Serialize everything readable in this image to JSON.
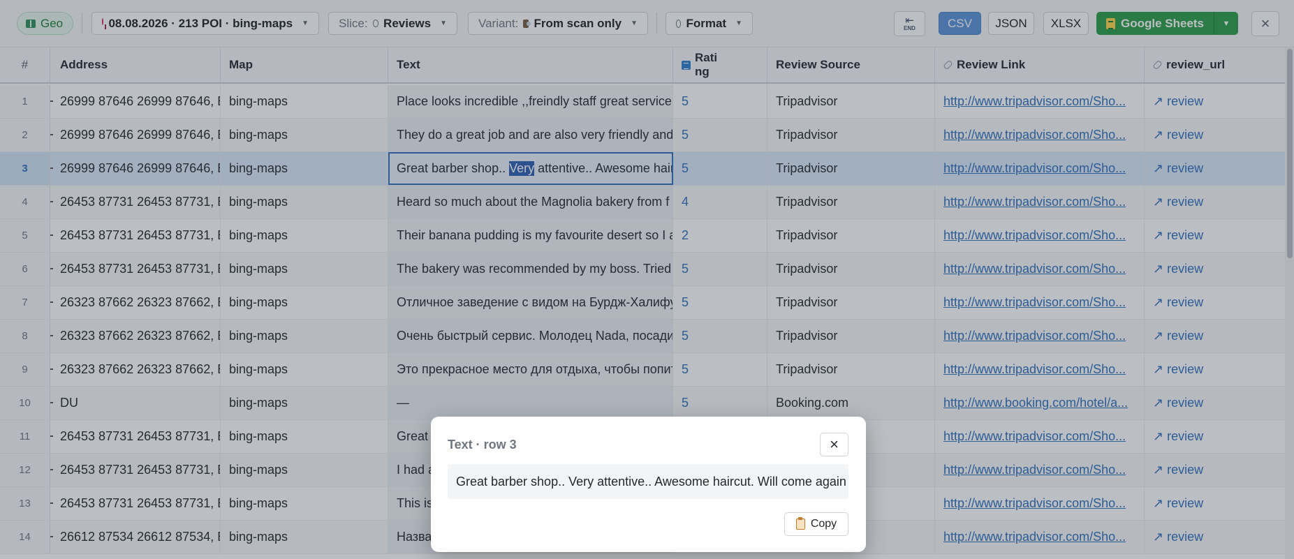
{
  "toolbar": {
    "geo": {
      "label": "Geo"
    },
    "date": {
      "value": "08.08.2026 · 213 POI · bing-maps"
    },
    "slice": {
      "label": "Slice:",
      "value": "Reviews"
    },
    "variant": {
      "label": "Variant:",
      "value": "From scan only"
    },
    "format": {
      "label": "Format"
    },
    "end_button": {
      "label": "END"
    },
    "export": {
      "csv": "CSV",
      "json": "JSON",
      "xlsx": "XLSX",
      "google_sheets": "Google Sheets"
    },
    "close": "×"
  },
  "table": {
    "columns": {
      "num": "#",
      "address": "Address",
      "map": "Map",
      "text": "Text",
      "rating_1": "Rati",
      "rating_2": "ng",
      "source": "Review Source",
      "link": "Review Link",
      "url": "review_url"
    },
    "rows": [
      {
        "num": "1",
        "address": "26999 87646 26999 87646, B",
        "map": "bing-maps",
        "text": "Place looks incredible ,,freindly staff great service",
        "rating": "5",
        "source": "Tripadvisor",
        "link": "http://www.tripadvisor.com/Sho...",
        "url": "review"
      },
      {
        "num": "2",
        "address": "26999 87646 26999 87646, B",
        "map": "bing-maps",
        "text": "They do a great job and are also very friendly and",
        "rating": "5",
        "source": "Tripadvisor",
        "link": "http://www.tripadvisor.com/Sho...",
        "url": "review"
      },
      {
        "num": "3",
        "address": "26999 87646 26999 87646, B",
        "map": "bing-maps",
        "text_pre": "Great barber shop.. ",
        "text_hl": "Very",
        "text_post": " attentive.. Awesome haircut. Will come again",
        "rating": "5",
        "source": "Tripadvisor",
        "link": "http://www.tripadvisor.com/Sho...",
        "url": "review"
      },
      {
        "num": "4",
        "address": "26453 87731 26453 87731, B",
        "map": "bing-maps",
        "text": "Heard so much about the Magnolia bakery from f",
        "rating": "4",
        "source": "Tripadvisor",
        "link": "http://www.tripadvisor.com/Sho...",
        "url": "review"
      },
      {
        "num": "5",
        "address": "26453 87731 26453 87731, B",
        "map": "bing-maps",
        "text": "Their banana pudding is my favourite desert so I a",
        "rating": "2",
        "source": "Tripadvisor",
        "link": "http://www.tripadvisor.com/Sho...",
        "url": "review"
      },
      {
        "num": "6",
        "address": "26453 87731 26453 87731, B",
        "map": "bing-maps",
        "text": "The bakery was recommended by my boss. Tried t",
        "rating": "5",
        "source": "Tripadvisor",
        "link": "http://www.tripadvisor.com/Sho...",
        "url": "review"
      },
      {
        "num": "7",
        "address": "26323 87662 26323 87662, B",
        "map": "bing-maps",
        "text": "Отличное заведение с видом на Бурдж-Халифу",
        "rating": "5",
        "source": "Tripadvisor",
        "link": "http://www.tripadvisor.com/Sho...",
        "url": "review"
      },
      {
        "num": "8",
        "address": "26323 87662 26323 87662, B",
        "map": "bing-maps",
        "text": "Очень быстрый сервис. Молодец Nada, посади.",
        "rating": "5",
        "source": "Tripadvisor",
        "link": "http://www.tripadvisor.com/Sho...",
        "url": "review"
      },
      {
        "num": "9",
        "address": "26323 87662 26323 87662, B",
        "map": "bing-maps",
        "text": "Это прекрасное место для отдыха, чтобы попит",
        "rating": "5",
        "source": "Tripadvisor",
        "link": "http://www.tripadvisor.com/Sho...",
        "url": "review"
      },
      {
        "num": "10",
        "address": "DU",
        "map": "bing-maps",
        "text": "—",
        "rating": "5",
        "source": "Booking.com",
        "link": "http://www.booking.com/hotel/a...",
        "url": "review"
      },
      {
        "num": "11",
        "address": "26453 87731 26453 87731, B",
        "map": "bing-maps",
        "text": "Great",
        "rating": "",
        "source": "",
        "link": "http://www.tripadvisor.com/Sho...",
        "url": "review"
      },
      {
        "num": "12",
        "address": "26453 87731 26453 87731, B",
        "map": "bing-maps",
        "text": "I had a",
        "rating": "",
        "source": "",
        "link": "http://www.tripadvisor.com/Sho...",
        "url": "review"
      },
      {
        "num": "13",
        "address": "26453 87731 26453 87731, B",
        "map": "bing-maps",
        "text": "This is",
        "rating": "",
        "source": "",
        "link": "http://www.tripadvisor.com/Sho...",
        "url": "review"
      },
      {
        "num": "14",
        "address": "26612 87534 26612 87534, B",
        "map": "bing-maps",
        "text": "Назва",
        "rating": "",
        "source": "",
        "link": "http://www.tripadvisor.com/Sho...",
        "url": "review"
      }
    ]
  },
  "modal": {
    "title": "Text · row 3",
    "text": "Great barber shop.. Very attentive.. Awesome haircut. Will come again",
    "copy_label": "Copy",
    "close": "×"
  },
  "colors": {
    "accent": "#2f6fbe",
    "csv_active": "#5a93d9",
    "sheets_green": "#2a9d48",
    "selected_row": "#dbe9f9"
  }
}
